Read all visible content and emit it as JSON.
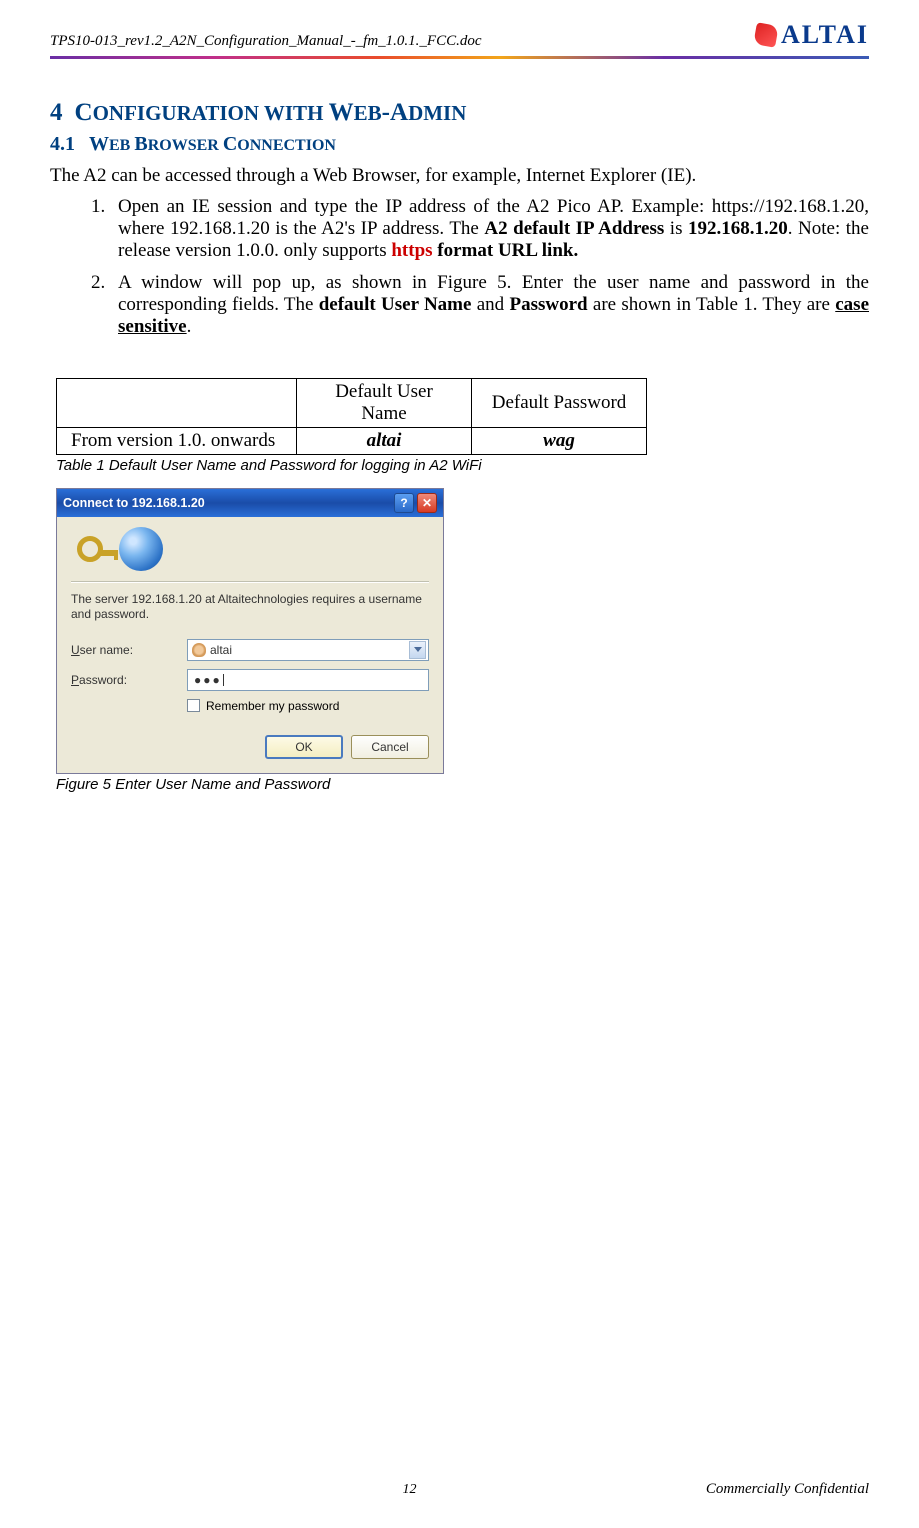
{
  "header": {
    "doc_title": "TPS10-013_rev1.2_A2N_Configuration_Manual_-_fm_1.0.1._FCC.doc",
    "logo_text": "ALTAI"
  },
  "section": {
    "number": "4",
    "title_a": "C",
    "title_b": "ONFIGURATION WITH ",
    "title_c": "W",
    "title_d": "EB",
    "title_e": "-A",
    "title_f": "DMIN"
  },
  "subsection": {
    "number": "4.1",
    "title_a": "W",
    "title_b": "EB ",
    "title_c": "B",
    "title_d": "ROWSER ",
    "title_e": "C",
    "title_f": "ONNECTION"
  },
  "intro": "The A2 can be accessed through a Web Browser, for example, Internet Explorer (IE).",
  "step1": {
    "a": "Open an IE session and type the IP address of the A2 Pico AP. Example: https://192.168.1.20, where 192.168.1.20 is the A2's IP address. The ",
    "b": "A2 default IP Address",
    "c": " is ",
    "d": "192.168.1.20",
    "e": ". Note: the release version 1.0.0. only supports ",
    "f": "https",
    "g": " format URL link."
  },
  "step2": {
    "a": "A window will pop up, as shown in Figure 5.    Enter the user name and password in the corresponding fields. The ",
    "b": "default User Name",
    "c": " and ",
    "d": "Password",
    "e": " are shown in Table 1. They are ",
    "f": "case sensitive",
    "g": "."
  },
  "table": {
    "h1": "",
    "h2": "Default User Name",
    "h3": "Default Password",
    "r1c1": "From version 1.0. onwards",
    "r1c2": "altai",
    "r1c3": "wag",
    "caption": "Table 1    Default User Name and Password for logging in A2 WiFi"
  },
  "dialog": {
    "title": "Connect to 192.168.1.20",
    "message": "The server 192.168.1.20 at Altaitechnologies requires a username and password.",
    "user_label_u": "U",
    "user_label_rest": "ser name:",
    "user_value": "altai",
    "pass_label_u": "P",
    "pass_label_rest": "assword:",
    "pass_value": "●●●",
    "remember_u": "R",
    "remember_rest": "emember my password",
    "ok": "OK",
    "cancel": "Cancel"
  },
  "figure_caption": "Figure 5      Enter User Name and Password",
  "footer": {
    "page": "12",
    "confidential": "Commercially Confidential"
  }
}
